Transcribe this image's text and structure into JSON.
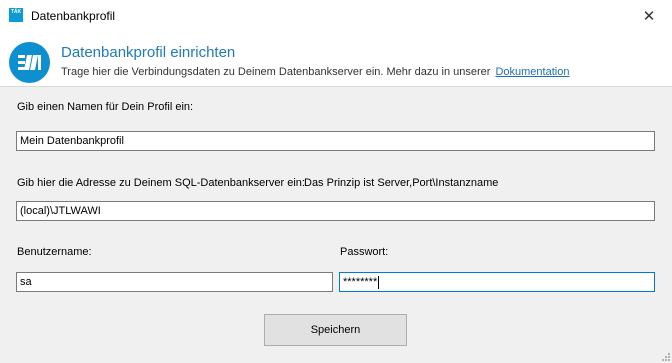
{
  "window": {
    "title": "Datenbankprofil",
    "app_icon_text": "TÄK",
    "close_glyph": "✕"
  },
  "header": {
    "title": "Datenbankprofil einrichten",
    "description": "Trage hier die Verbindungsdaten zu Deinem Datenbankserver ein. Mehr dazu in unserer",
    "link_label": "Dokumentation"
  },
  "form": {
    "profile_name_label": "Gib einen Namen für Dein Profil ein:",
    "profile_name_value": "Mein Datenbankprofil",
    "server_label": "Gib hier die Adresse zu Deinem SQL-Datenbankserver ein:",
    "server_hint": "Das Prinzip ist Server,Port\\Instanzname",
    "server_value": "(local)\\JTLWAWI",
    "username_label": "Benutzername:",
    "username_value": "sa",
    "password_label": "Passwort:",
    "password_value": "********",
    "save_label": "Speichern"
  },
  "colors": {
    "accent": "#1e7bbe",
    "logo_bg": "#0d8fd0",
    "focus_border": "#0078d7"
  }
}
